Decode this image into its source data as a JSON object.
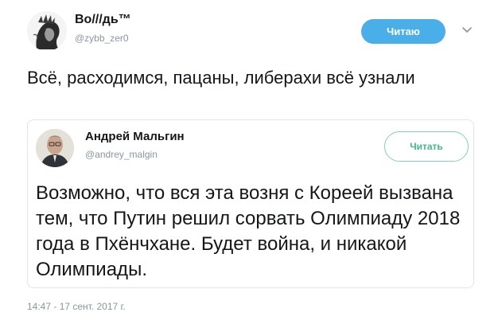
{
  "tweet": {
    "author": {
      "display_name": "Во///дь™",
      "handle": "@zybb_zer0"
    },
    "follow_label": "Читаю",
    "text": "Всё, расходимся, пацаны, либерахи всё узнали",
    "timestamp": "14:47 - 17 сент. 2017 г."
  },
  "quote": {
    "author": {
      "display_name": "Андрей Мальгин",
      "handle": "@andrey_malgin"
    },
    "follow_label": "Читать",
    "text": "Возможно, что вся эта возня с Кореей вызвана тем, что Путин решил сорвать Олимпиаду 2018 года в Пхёнчхане. Будет война, и никакой Олимпиады."
  },
  "colors": {
    "follow_bg": "#4aaee8",
    "follow_outline": "#7fd3b4",
    "secondary_text": "#8a959e"
  },
  "icons": [
    "user-avatar",
    "quoted-avatar",
    "chevron-down-icon"
  ]
}
